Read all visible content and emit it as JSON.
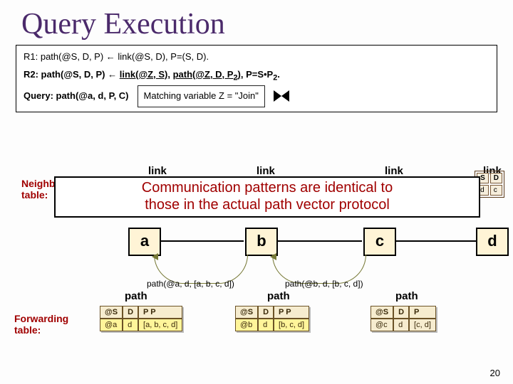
{
  "title": "Query Execution",
  "rules": {
    "r1": "R1: path(@S, D, P) ← link(@S, D), P=(S, D).",
    "r2_a": "R2: path(@S, D, P) ← ",
    "r2_b": "link(@Z, S)",
    "r2_c": ", ",
    "r2_d": "path(@Z, D, P",
    "r2_e": "2",
    "r2_f": ")",
    "r2_g": ", P=S•P",
    "r2_h": "2",
    "r2_i": ".",
    "query_label": "Query: path(@a, d, P, C)",
    "match_label": "Matching variable Z = \"Join\""
  },
  "link_headers": [
    "link",
    "link",
    "link",
    "link"
  ],
  "neighbor_label_l1": "Neighbor",
  "neighbor_label_l2": "table:",
  "right_mini": {
    "h1": "S",
    "h2": "D",
    "r1": "d",
    "r2": "c"
  },
  "overlay_l1": "Communication patterns are identical to",
  "overlay_l2": "those in the actual path vector protocol",
  "nodes": [
    "a",
    "b",
    "c",
    "d"
  ],
  "path_msg_a": "path(@a, d, [a, b, c, d])",
  "path_msg_b": "path(@b, d, [b, c, d])",
  "path_headers": [
    "path",
    "path",
    "path"
  ],
  "fwd_label_l1": "Forwarding",
  "fwd_label_l2": "table:",
  "fwd_tables": [
    {
      "cols": [
        "@S",
        "D",
        "P P"
      ],
      "row": [
        "@a",
        "d",
        "[a, b, c, d]"
      ]
    },
    {
      "cols": [
        "@S",
        "D",
        "P P"
      ],
      "row": [
        "@b",
        "d",
        "[b, c, d]"
      ]
    },
    {
      "cols": [
        "@S",
        "D",
        "P"
      ],
      "row": [
        "@c",
        "d",
        "[c, d]"
      ]
    }
  ],
  "page_number": "20"
}
